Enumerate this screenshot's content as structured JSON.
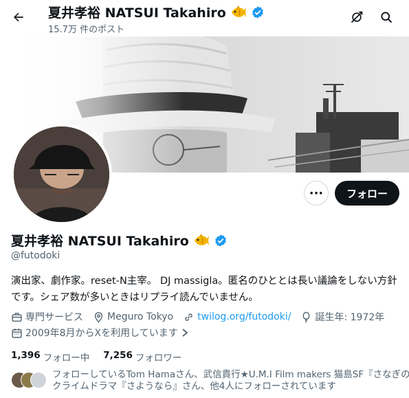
{
  "header": {
    "title": "夏井孝裕 NATSUI Takahiro",
    "post_count": "15.7万 件のポスト"
  },
  "profile": {
    "display_name": "夏井孝裕 NATSUI Takahiro",
    "handle": "@futodoki",
    "follow_label": "フォロー",
    "more_label": "···",
    "bio": [
      "演出家、劇作家。reset-N主宰。 DJ massigla。匿名のひととは長い議論をしない方針",
      "です。シェア数が多いときはリプライ読んでいません。"
    ],
    "category": "専門サービス",
    "location": "Meguro Tokyo",
    "website": "twilog.org/futodoki/",
    "birth": "誕生年: 1972年",
    "joined": "2009年8月からXを利用しています"
  },
  "stats": {
    "following_count": "1,396",
    "following_label": "フォロー中",
    "followers_count": "7,256",
    "followers_label": "フォロワー"
  },
  "followed_by": {
    "lines": [
      "フォローしているTom Hamaさん、武信貴行★U.M.I Film makers 猫島SF『さなぎの猫』",
      "クライムドラマ『さようなら』さん、他4人にフォローされています"
    ]
  },
  "colors": {
    "accent": "#1d9bf0",
    "text": "#0f1419",
    "muted": "#536471",
    "button_dark": "#0f1419"
  },
  "icons": {
    "back": "arrow-left-icon",
    "spaces": "spaces-icon",
    "search": "search-icon",
    "verified": "verified-badge-icon",
    "fish": "fish-emoji-icon"
  }
}
